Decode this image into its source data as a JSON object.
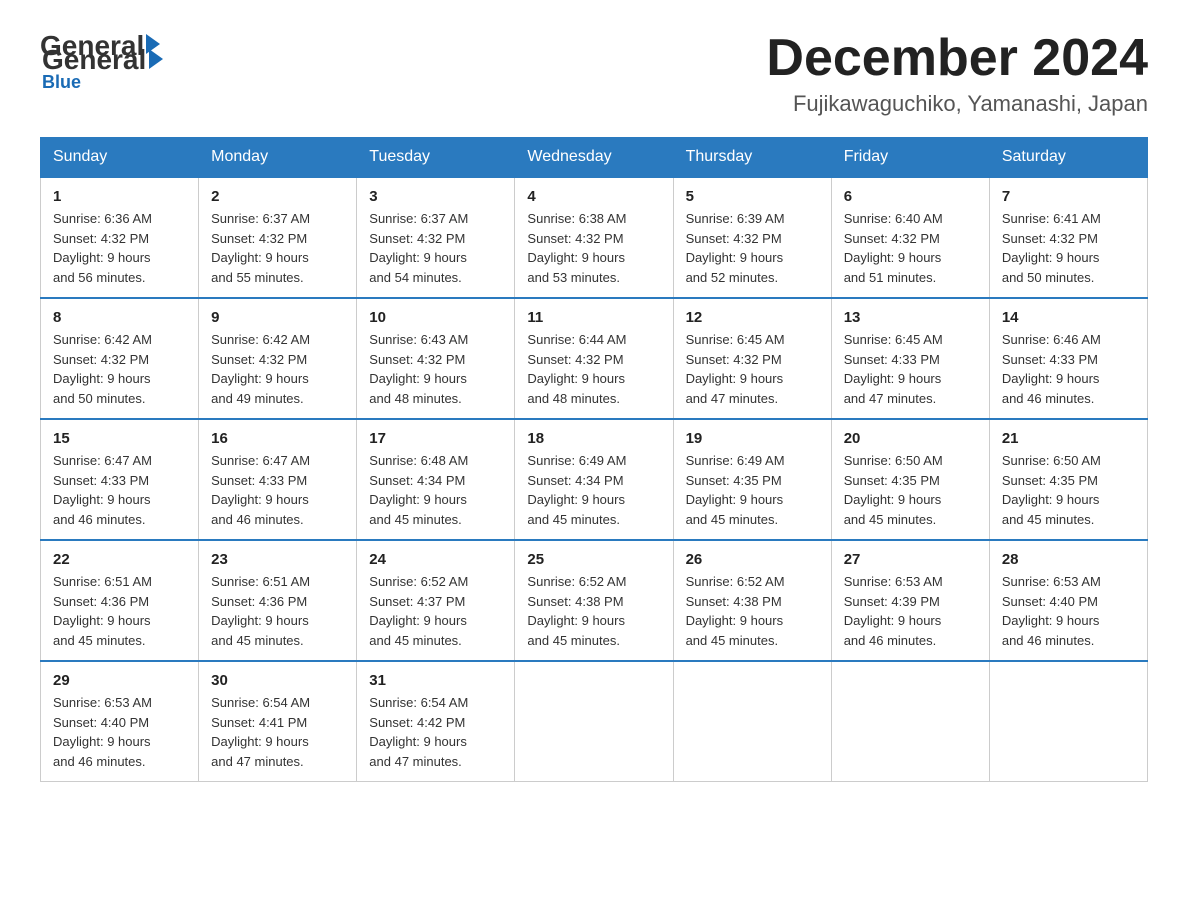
{
  "header": {
    "logo": {
      "general": "General",
      "arrow": "▶",
      "blue": "Blue"
    },
    "title": "December 2024",
    "location": "Fujikawaguchiko, Yamanashi, Japan"
  },
  "weekdays": [
    "Sunday",
    "Monday",
    "Tuesday",
    "Wednesday",
    "Thursday",
    "Friday",
    "Saturday"
  ],
  "weeks": [
    [
      {
        "day": "1",
        "sunrise": "6:36 AM",
        "sunset": "4:32 PM",
        "daylight": "9 hours and 56 minutes."
      },
      {
        "day": "2",
        "sunrise": "6:37 AM",
        "sunset": "4:32 PM",
        "daylight": "9 hours and 55 minutes."
      },
      {
        "day": "3",
        "sunrise": "6:37 AM",
        "sunset": "4:32 PM",
        "daylight": "9 hours and 54 minutes."
      },
      {
        "day": "4",
        "sunrise": "6:38 AM",
        "sunset": "4:32 PM",
        "daylight": "9 hours and 53 minutes."
      },
      {
        "day": "5",
        "sunrise": "6:39 AM",
        "sunset": "4:32 PM",
        "daylight": "9 hours and 52 minutes."
      },
      {
        "day": "6",
        "sunrise": "6:40 AM",
        "sunset": "4:32 PM",
        "daylight": "9 hours and 51 minutes."
      },
      {
        "day": "7",
        "sunrise": "6:41 AM",
        "sunset": "4:32 PM",
        "daylight": "9 hours and 50 minutes."
      }
    ],
    [
      {
        "day": "8",
        "sunrise": "6:42 AM",
        "sunset": "4:32 PM",
        "daylight": "9 hours and 50 minutes."
      },
      {
        "day": "9",
        "sunrise": "6:42 AM",
        "sunset": "4:32 PM",
        "daylight": "9 hours and 49 minutes."
      },
      {
        "day": "10",
        "sunrise": "6:43 AM",
        "sunset": "4:32 PM",
        "daylight": "9 hours and 48 minutes."
      },
      {
        "day": "11",
        "sunrise": "6:44 AM",
        "sunset": "4:32 PM",
        "daylight": "9 hours and 48 minutes."
      },
      {
        "day": "12",
        "sunrise": "6:45 AM",
        "sunset": "4:32 PM",
        "daylight": "9 hours and 47 minutes."
      },
      {
        "day": "13",
        "sunrise": "6:45 AM",
        "sunset": "4:33 PM",
        "daylight": "9 hours and 47 minutes."
      },
      {
        "day": "14",
        "sunrise": "6:46 AM",
        "sunset": "4:33 PM",
        "daylight": "9 hours and 46 minutes."
      }
    ],
    [
      {
        "day": "15",
        "sunrise": "6:47 AM",
        "sunset": "4:33 PM",
        "daylight": "9 hours and 46 minutes."
      },
      {
        "day": "16",
        "sunrise": "6:47 AM",
        "sunset": "4:33 PM",
        "daylight": "9 hours and 46 minutes."
      },
      {
        "day": "17",
        "sunrise": "6:48 AM",
        "sunset": "4:34 PM",
        "daylight": "9 hours and 45 minutes."
      },
      {
        "day": "18",
        "sunrise": "6:49 AM",
        "sunset": "4:34 PM",
        "daylight": "9 hours and 45 minutes."
      },
      {
        "day": "19",
        "sunrise": "6:49 AM",
        "sunset": "4:35 PM",
        "daylight": "9 hours and 45 minutes."
      },
      {
        "day": "20",
        "sunrise": "6:50 AM",
        "sunset": "4:35 PM",
        "daylight": "9 hours and 45 minutes."
      },
      {
        "day": "21",
        "sunrise": "6:50 AM",
        "sunset": "4:35 PM",
        "daylight": "9 hours and 45 minutes."
      }
    ],
    [
      {
        "day": "22",
        "sunrise": "6:51 AM",
        "sunset": "4:36 PM",
        "daylight": "9 hours and 45 minutes."
      },
      {
        "day": "23",
        "sunrise": "6:51 AM",
        "sunset": "4:36 PM",
        "daylight": "9 hours and 45 minutes."
      },
      {
        "day": "24",
        "sunrise": "6:52 AM",
        "sunset": "4:37 PM",
        "daylight": "9 hours and 45 minutes."
      },
      {
        "day": "25",
        "sunrise": "6:52 AM",
        "sunset": "4:38 PM",
        "daylight": "9 hours and 45 minutes."
      },
      {
        "day": "26",
        "sunrise": "6:52 AM",
        "sunset": "4:38 PM",
        "daylight": "9 hours and 45 minutes."
      },
      {
        "day": "27",
        "sunrise": "6:53 AM",
        "sunset": "4:39 PM",
        "daylight": "9 hours and 46 minutes."
      },
      {
        "day": "28",
        "sunrise": "6:53 AM",
        "sunset": "4:40 PM",
        "daylight": "9 hours and 46 minutes."
      }
    ],
    [
      {
        "day": "29",
        "sunrise": "6:53 AM",
        "sunset": "4:40 PM",
        "daylight": "9 hours and 46 minutes."
      },
      {
        "day": "30",
        "sunrise": "6:54 AM",
        "sunset": "4:41 PM",
        "daylight": "9 hours and 47 minutes."
      },
      {
        "day": "31",
        "sunrise": "6:54 AM",
        "sunset": "4:42 PM",
        "daylight": "9 hours and 47 minutes."
      },
      null,
      null,
      null,
      null
    ]
  ],
  "labels": {
    "sunrise": "Sunrise:",
    "sunset": "Sunset:",
    "daylight": "Daylight:"
  },
  "colors": {
    "header_bg": "#2a7abf",
    "header_text": "#ffffff",
    "border_top": "#2a7abf"
  }
}
